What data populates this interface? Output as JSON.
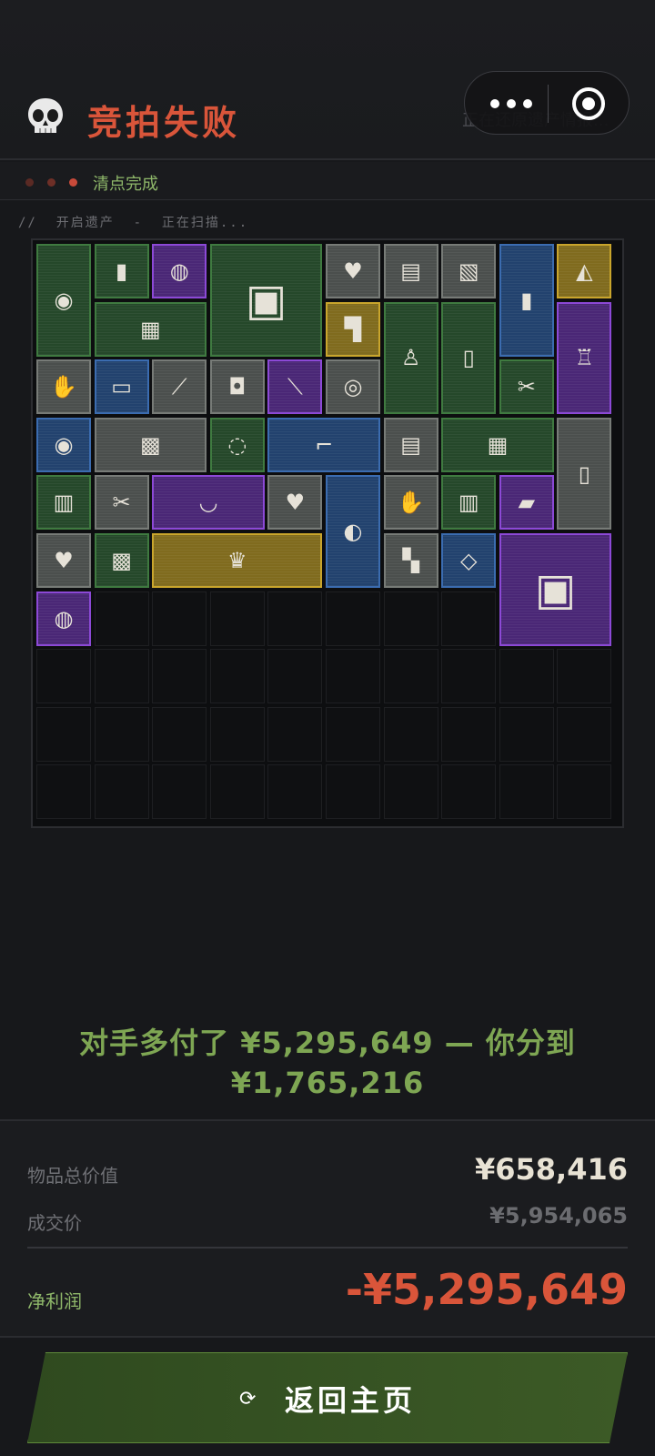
{
  "header": {
    "title": "竞拍失败",
    "restoring_text": "正在还原遗产情报...",
    "title_color": "#d9553a"
  },
  "status": {
    "dots": [
      "#5a2a24",
      "#6e2f27",
      "#c84a3a"
    ],
    "label": "清点完成"
  },
  "scan": {
    "text": "//  开启遗产  -  正在扫描..."
  },
  "inventory": {
    "columns": 10,
    "rows": 10,
    "items": [
      {
        "name": "gauge-item",
        "rarity": "green",
        "icon": "◉",
        "c": 0,
        "r": 0,
        "w": 1,
        "h": 2
      },
      {
        "name": "lighter-item",
        "rarity": "green",
        "icon": "▮",
        "c": 1,
        "r": 0,
        "w": 1,
        "h": 1
      },
      {
        "name": "ball-item",
        "rarity": "purple",
        "icon": "◍",
        "c": 2,
        "r": 0,
        "w": 1,
        "h": 1
      },
      {
        "name": "psu-item",
        "rarity": "green",
        "icon": "▣",
        "c": 3,
        "r": 0,
        "w": 2,
        "h": 2
      },
      {
        "name": "card-item",
        "rarity": "gray",
        "icon": "♥",
        "c": 5,
        "r": 0,
        "w": 1,
        "h": 1
      },
      {
        "name": "protein-can-item",
        "rarity": "gray",
        "icon": "▤",
        "c": 6,
        "r": 0,
        "w": 1,
        "h": 1
      },
      {
        "name": "snack-item",
        "rarity": "gray",
        "icon": "▧",
        "c": 7,
        "r": 0,
        "w": 1,
        "h": 1
      },
      {
        "name": "black-powder-item",
        "rarity": "blue",
        "icon": "▮",
        "c": 8,
        "r": 0,
        "w": 1,
        "h": 2
      },
      {
        "name": "cheese-item",
        "rarity": "gold",
        "icon": "◭",
        "c": 9,
        "r": 0,
        "w": 1,
        "h": 1
      },
      {
        "name": "blueprint-item",
        "rarity": "green",
        "icon": "▦",
        "c": 1,
        "r": 1,
        "w": 2,
        "h": 1
      },
      {
        "name": "inhaler-item",
        "rarity": "gold",
        "icon": "▜",
        "c": 5,
        "r": 1,
        "w": 1,
        "h": 1
      },
      {
        "name": "statue-item",
        "rarity": "green",
        "icon": "♙",
        "c": 6,
        "r": 1,
        "w": 1,
        "h": 2
      },
      {
        "name": "spray-can-item",
        "rarity": "green",
        "icon": "▯",
        "c": 7,
        "r": 1,
        "w": 1,
        "h": 2
      },
      {
        "name": "lantern-item",
        "rarity": "purple",
        "icon": "♖",
        "c": 9,
        "r": 1,
        "w": 1,
        "h": 2
      },
      {
        "name": "glove-item",
        "rarity": "gray",
        "icon": "✋",
        "c": 0,
        "r": 2,
        "w": 1,
        "h": 1
      },
      {
        "name": "usb-item",
        "rarity": "blue",
        "icon": "▭",
        "c": 1,
        "r": 2,
        "w": 1,
        "h": 1
      },
      {
        "name": "brush-item",
        "rarity": "gray",
        "icon": "⟋",
        "c": 2,
        "r": 2,
        "w": 1,
        "h": 1
      },
      {
        "name": "tape-measure-item",
        "rarity": "gray",
        "icon": "◘",
        "c": 3,
        "r": 2,
        "w": 1,
        "h": 1
      },
      {
        "name": "flashlight-item",
        "rarity": "purple",
        "icon": "⟍",
        "c": 4,
        "r": 2,
        "w": 1,
        "h": 1
      },
      {
        "name": "disc-item",
        "rarity": "gray",
        "icon": "◎",
        "c": 5,
        "r": 2,
        "w": 1,
        "h": 1
      },
      {
        "name": "pliers-item",
        "rarity": "green",
        "icon": "✂",
        "c": 8,
        "r": 2,
        "w": 1,
        "h": 1
      },
      {
        "name": "coin-item",
        "rarity": "blue",
        "icon": "◉",
        "c": 0,
        "r": 3,
        "w": 1,
        "h": 1
      },
      {
        "name": "photo-item",
        "rarity": "gray",
        "icon": "▩",
        "c": 1,
        "r": 3,
        "w": 2,
        "h": 1
      },
      {
        "name": "hose-item",
        "rarity": "green",
        "icon": "◌",
        "c": 3,
        "r": 3,
        "w": 1,
        "h": 1
      },
      {
        "name": "pipe-item",
        "rarity": "blue",
        "icon": "⌐",
        "c": 4,
        "r": 3,
        "w": 2,
        "h": 1
      },
      {
        "name": "protein-can-item",
        "rarity": "gray",
        "icon": "▤",
        "c": 6,
        "r": 3,
        "w": 1,
        "h": 1
      },
      {
        "name": "map-item",
        "rarity": "green",
        "icon": "▦",
        "c": 7,
        "r": 3,
        "w": 2,
        "h": 1
      },
      {
        "name": "toothpaste-item",
        "rarity": "gray",
        "icon": "▯",
        "c": 9,
        "r": 3,
        "w": 1,
        "h": 2
      },
      {
        "name": "jar-item",
        "rarity": "green",
        "icon": "▥",
        "c": 0,
        "r": 4,
        "w": 1,
        "h": 1
      },
      {
        "name": "scissors-item",
        "rarity": "gray",
        "icon": "✂",
        "c": 1,
        "r": 4,
        "w": 1,
        "h": 1
      },
      {
        "name": "necklace-item",
        "rarity": "purple",
        "icon": "◡",
        "c": 2,
        "r": 4,
        "w": 2,
        "h": 1
      },
      {
        "name": "card-item",
        "rarity": "gray",
        "icon": "♥",
        "c": 4,
        "r": 4,
        "w": 1,
        "h": 1
      },
      {
        "name": "stethoscope-item",
        "rarity": "blue",
        "icon": "◐",
        "c": 5,
        "r": 4,
        "w": 1,
        "h": 2
      },
      {
        "name": "glove-item",
        "rarity": "gray",
        "icon": "✋",
        "c": 6,
        "r": 4,
        "w": 1,
        "h": 1
      },
      {
        "name": "jar-item",
        "rarity": "green",
        "icon": "▥",
        "c": 7,
        "r": 4,
        "w": 1,
        "h": 1
      },
      {
        "name": "bar-item",
        "rarity": "purple",
        "icon": "▰",
        "c": 8,
        "r": 4,
        "w": 1,
        "h": 1
      },
      {
        "name": "card-item",
        "rarity": "gray",
        "icon": "♥",
        "c": 0,
        "r": 5,
        "w": 1,
        "h": 1
      },
      {
        "name": "circuit-board-item",
        "rarity": "green",
        "icon": "▩",
        "c": 1,
        "r": 5,
        "w": 1,
        "h": 1
      },
      {
        "name": "tiara-item",
        "rarity": "gold",
        "icon": "♛",
        "c": 2,
        "r": 5,
        "w": 3,
        "h": 1
      },
      {
        "name": "grip-item",
        "rarity": "gray",
        "icon": "▚",
        "c": 6,
        "r": 5,
        "w": 1,
        "h": 1
      },
      {
        "name": "metal-sheet-item",
        "rarity": "blue",
        "icon": "◇",
        "c": 7,
        "r": 5,
        "w": 1,
        "h": 1
      },
      {
        "name": "incubator-item",
        "rarity": "purple",
        "icon": "▣",
        "c": 8,
        "r": 5,
        "w": 2,
        "h": 2
      },
      {
        "name": "ring-item",
        "rarity": "purple",
        "icon": "◍",
        "c": 0,
        "r": 6,
        "w": 1,
        "h": 1
      }
    ]
  },
  "result": {
    "line1": "对手多付了 ¥5,295,649 — 你分到",
    "line2": "¥1,765,216"
  },
  "summary": {
    "total_value_label": "物品总价值",
    "total_value": "¥658,416",
    "deal_price_label": "成交价",
    "deal_price": "¥5,954,065",
    "profit_label": "净利润",
    "profit": "-¥5,295,649",
    "profit_color": "#d9553a",
    "profit_label_color": "#8fb86a"
  },
  "button": {
    "label": "返回主页",
    "icon": "refresh-icon"
  }
}
